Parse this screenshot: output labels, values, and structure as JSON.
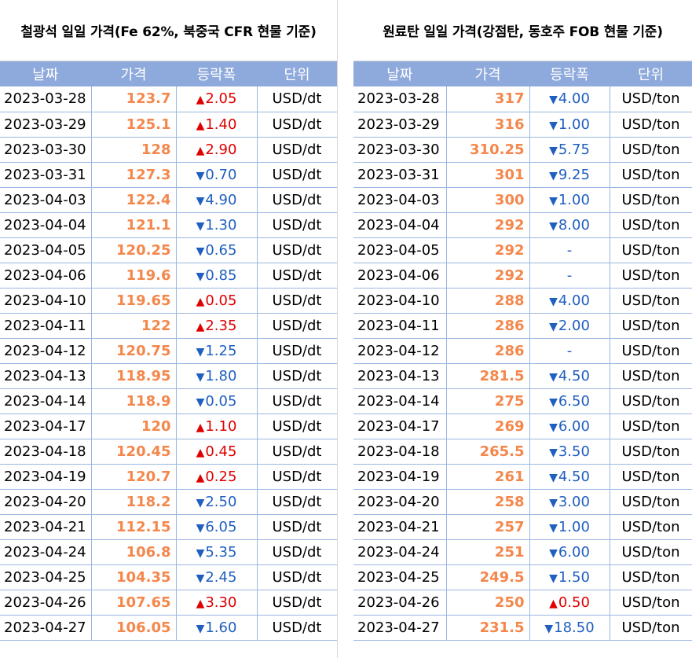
{
  "left": {
    "title": "철광석 일일 가격(Fe 62%, 북중국 CFR 현물 기준)",
    "headers": [
      "날짜",
      "가격",
      "등락폭",
      "단위"
    ],
    "rows": [
      {
        "date": "2023-03-28",
        "price": "123.7",
        "dir": "up",
        "arrow": "▲",
        "change": "2.05",
        "unit": "USD/dt"
      },
      {
        "date": "2023-03-29",
        "price": "125.1",
        "dir": "up",
        "arrow": "▲",
        "change": "1.40",
        "unit": "USD/dt"
      },
      {
        "date": "2023-03-30",
        "price": "128",
        "dir": "up",
        "arrow": "▲",
        "change": "2.90",
        "unit": "USD/dt"
      },
      {
        "date": "2023-03-31",
        "price": "127.3",
        "dir": "down",
        "arrow": "▼",
        "change": "0.70",
        "unit": "USD/dt"
      },
      {
        "date": "2023-04-03",
        "price": "122.4",
        "dir": "down",
        "arrow": "▼",
        "change": "4.90",
        "unit": "USD/dt"
      },
      {
        "date": "2023-04-04",
        "price": "121.1",
        "dir": "down",
        "arrow": "▼",
        "change": "1.30",
        "unit": "USD/dt"
      },
      {
        "date": "2023-04-05",
        "price": "120.25",
        "dir": "down",
        "arrow": "▼",
        "change": "0.65",
        "unit": "USD/dt"
      },
      {
        "date": "2023-04-06",
        "price": "119.6",
        "dir": "down",
        "arrow": "▼",
        "change": "0.85",
        "unit": "USD/dt"
      },
      {
        "date": "2023-04-10",
        "price": "119.65",
        "dir": "up",
        "arrow": "▲",
        "change": "0.05",
        "unit": "USD/dt"
      },
      {
        "date": "2023-04-11",
        "price": "122",
        "dir": "up",
        "arrow": "▲",
        "change": "2.35",
        "unit": "USD/dt"
      },
      {
        "date": "2023-04-12",
        "price": "120.75",
        "dir": "down",
        "arrow": "▼",
        "change": "1.25",
        "unit": "USD/dt"
      },
      {
        "date": "2023-04-13",
        "price": "118.95",
        "dir": "down",
        "arrow": "▼",
        "change": "1.80",
        "unit": "USD/dt"
      },
      {
        "date": "2023-04-14",
        "price": "118.9",
        "dir": "down",
        "arrow": "▼",
        "change": "0.05",
        "unit": "USD/dt"
      },
      {
        "date": "2023-04-17",
        "price": "120",
        "dir": "up",
        "arrow": "▲",
        "change": "1.10",
        "unit": "USD/dt"
      },
      {
        "date": "2023-04-18",
        "price": "120.45",
        "dir": "up",
        "arrow": "▲",
        "change": "0.45",
        "unit": "USD/dt"
      },
      {
        "date": "2023-04-19",
        "price": "120.7",
        "dir": "up",
        "arrow": "▲",
        "change": "0.25",
        "unit": "USD/dt"
      },
      {
        "date": "2023-04-20",
        "price": "118.2",
        "dir": "down",
        "arrow": "▼",
        "change": "2.50",
        "unit": "USD/dt"
      },
      {
        "date": "2023-04-21",
        "price": "112.15",
        "dir": "down",
        "arrow": "▼",
        "change": "6.05",
        "unit": "USD/dt"
      },
      {
        "date": "2023-04-24",
        "price": "106.8",
        "dir": "down",
        "arrow": "▼",
        "change": "5.35",
        "unit": "USD/dt"
      },
      {
        "date": "2023-04-25",
        "price": "104.35",
        "dir": "down",
        "arrow": "▼",
        "change": "2.45",
        "unit": "USD/dt"
      },
      {
        "date": "2023-04-26",
        "price": "107.65",
        "dir": "up",
        "arrow": "▲",
        "change": "3.30",
        "unit": "USD/dt"
      },
      {
        "date": "2023-04-27",
        "price": "106.05",
        "dir": "down",
        "arrow": "▼",
        "change": "1.60",
        "unit": "USD/dt"
      }
    ]
  },
  "right": {
    "title": "원료탄 일일 가격(강점탄, 동호주 FOB 현물 기준)",
    "headers": [
      "날짜",
      "가격",
      "등락폭",
      "단위"
    ],
    "rows": [
      {
        "date": "2023-03-28",
        "price": "317",
        "dir": "down",
        "arrow": "▼",
        "change": "4.00",
        "unit": "USD/ton"
      },
      {
        "date": "2023-03-29",
        "price": "316",
        "dir": "down",
        "arrow": "▼",
        "change": "1.00",
        "unit": "USD/ton"
      },
      {
        "date": "2023-03-30",
        "price": "310.25",
        "dir": "down",
        "arrow": "▼",
        "change": "5.75",
        "unit": "USD/ton"
      },
      {
        "date": "2023-03-31",
        "price": "301",
        "dir": "down",
        "arrow": "▼",
        "change": "9.25",
        "unit": "USD/ton"
      },
      {
        "date": "2023-04-03",
        "price": "300",
        "dir": "down",
        "arrow": "▼",
        "change": "1.00",
        "unit": "USD/ton"
      },
      {
        "date": "2023-04-04",
        "price": "292",
        "dir": "down",
        "arrow": "▼",
        "change": "8.00",
        "unit": "USD/ton"
      },
      {
        "date": "2023-04-05",
        "price": "292",
        "dir": "flat",
        "arrow": "",
        "change": "-",
        "unit": "USD/ton"
      },
      {
        "date": "2023-04-06",
        "price": "292",
        "dir": "flat",
        "arrow": "",
        "change": "-",
        "unit": "USD/ton"
      },
      {
        "date": "2023-04-10",
        "price": "288",
        "dir": "down",
        "arrow": "▼",
        "change": "4.00",
        "unit": "USD/ton"
      },
      {
        "date": "2023-04-11",
        "price": "286",
        "dir": "down",
        "arrow": "▼",
        "change": "2.00",
        "unit": "USD/ton"
      },
      {
        "date": "2023-04-12",
        "price": "286",
        "dir": "flat",
        "arrow": "",
        "change": "-",
        "unit": "USD/ton"
      },
      {
        "date": "2023-04-13",
        "price": "281.5",
        "dir": "down",
        "arrow": "▼",
        "change": "4.50",
        "unit": "USD/ton"
      },
      {
        "date": "2023-04-14",
        "price": "275",
        "dir": "down",
        "arrow": "▼",
        "change": "6.50",
        "unit": "USD/ton"
      },
      {
        "date": "2023-04-17",
        "price": "269",
        "dir": "down",
        "arrow": "▼",
        "change": "6.00",
        "unit": "USD/ton"
      },
      {
        "date": "2023-04-18",
        "price": "265.5",
        "dir": "down",
        "arrow": "▼",
        "change": "3.50",
        "unit": "USD/ton"
      },
      {
        "date": "2023-04-19",
        "price": "261",
        "dir": "down",
        "arrow": "▼",
        "change": "4.50",
        "unit": "USD/ton"
      },
      {
        "date": "2023-04-20",
        "price": "258",
        "dir": "down",
        "arrow": "▼",
        "change": "3.00",
        "unit": "USD/ton"
      },
      {
        "date": "2023-04-21",
        "price": "257",
        "dir": "down",
        "arrow": "▼",
        "change": "1.00",
        "unit": "USD/ton"
      },
      {
        "date": "2023-04-24",
        "price": "251",
        "dir": "down",
        "arrow": "▼",
        "change": "6.00",
        "unit": "USD/ton"
      },
      {
        "date": "2023-04-25",
        "price": "249.5",
        "dir": "down",
        "arrow": "▼",
        "change": "1.50",
        "unit": "USD/ton"
      },
      {
        "date": "2023-04-26",
        "price": "250",
        "dir": "up",
        "arrow": "▲",
        "change": "0.50",
        "unit": "USD/ton"
      },
      {
        "date": "2023-04-27",
        "price": "231.5",
        "dir": "down",
        "arrow": "▼",
        "change": "18.50",
        "unit": "USD/ton"
      }
    ]
  },
  "colors": {
    "header_bg": "#8ea9db",
    "header_text": "#ffffff",
    "price_text": "#f4874b",
    "up": "#e00000",
    "down": "#1f5fbf",
    "grid": "#9bb7e0"
  }
}
